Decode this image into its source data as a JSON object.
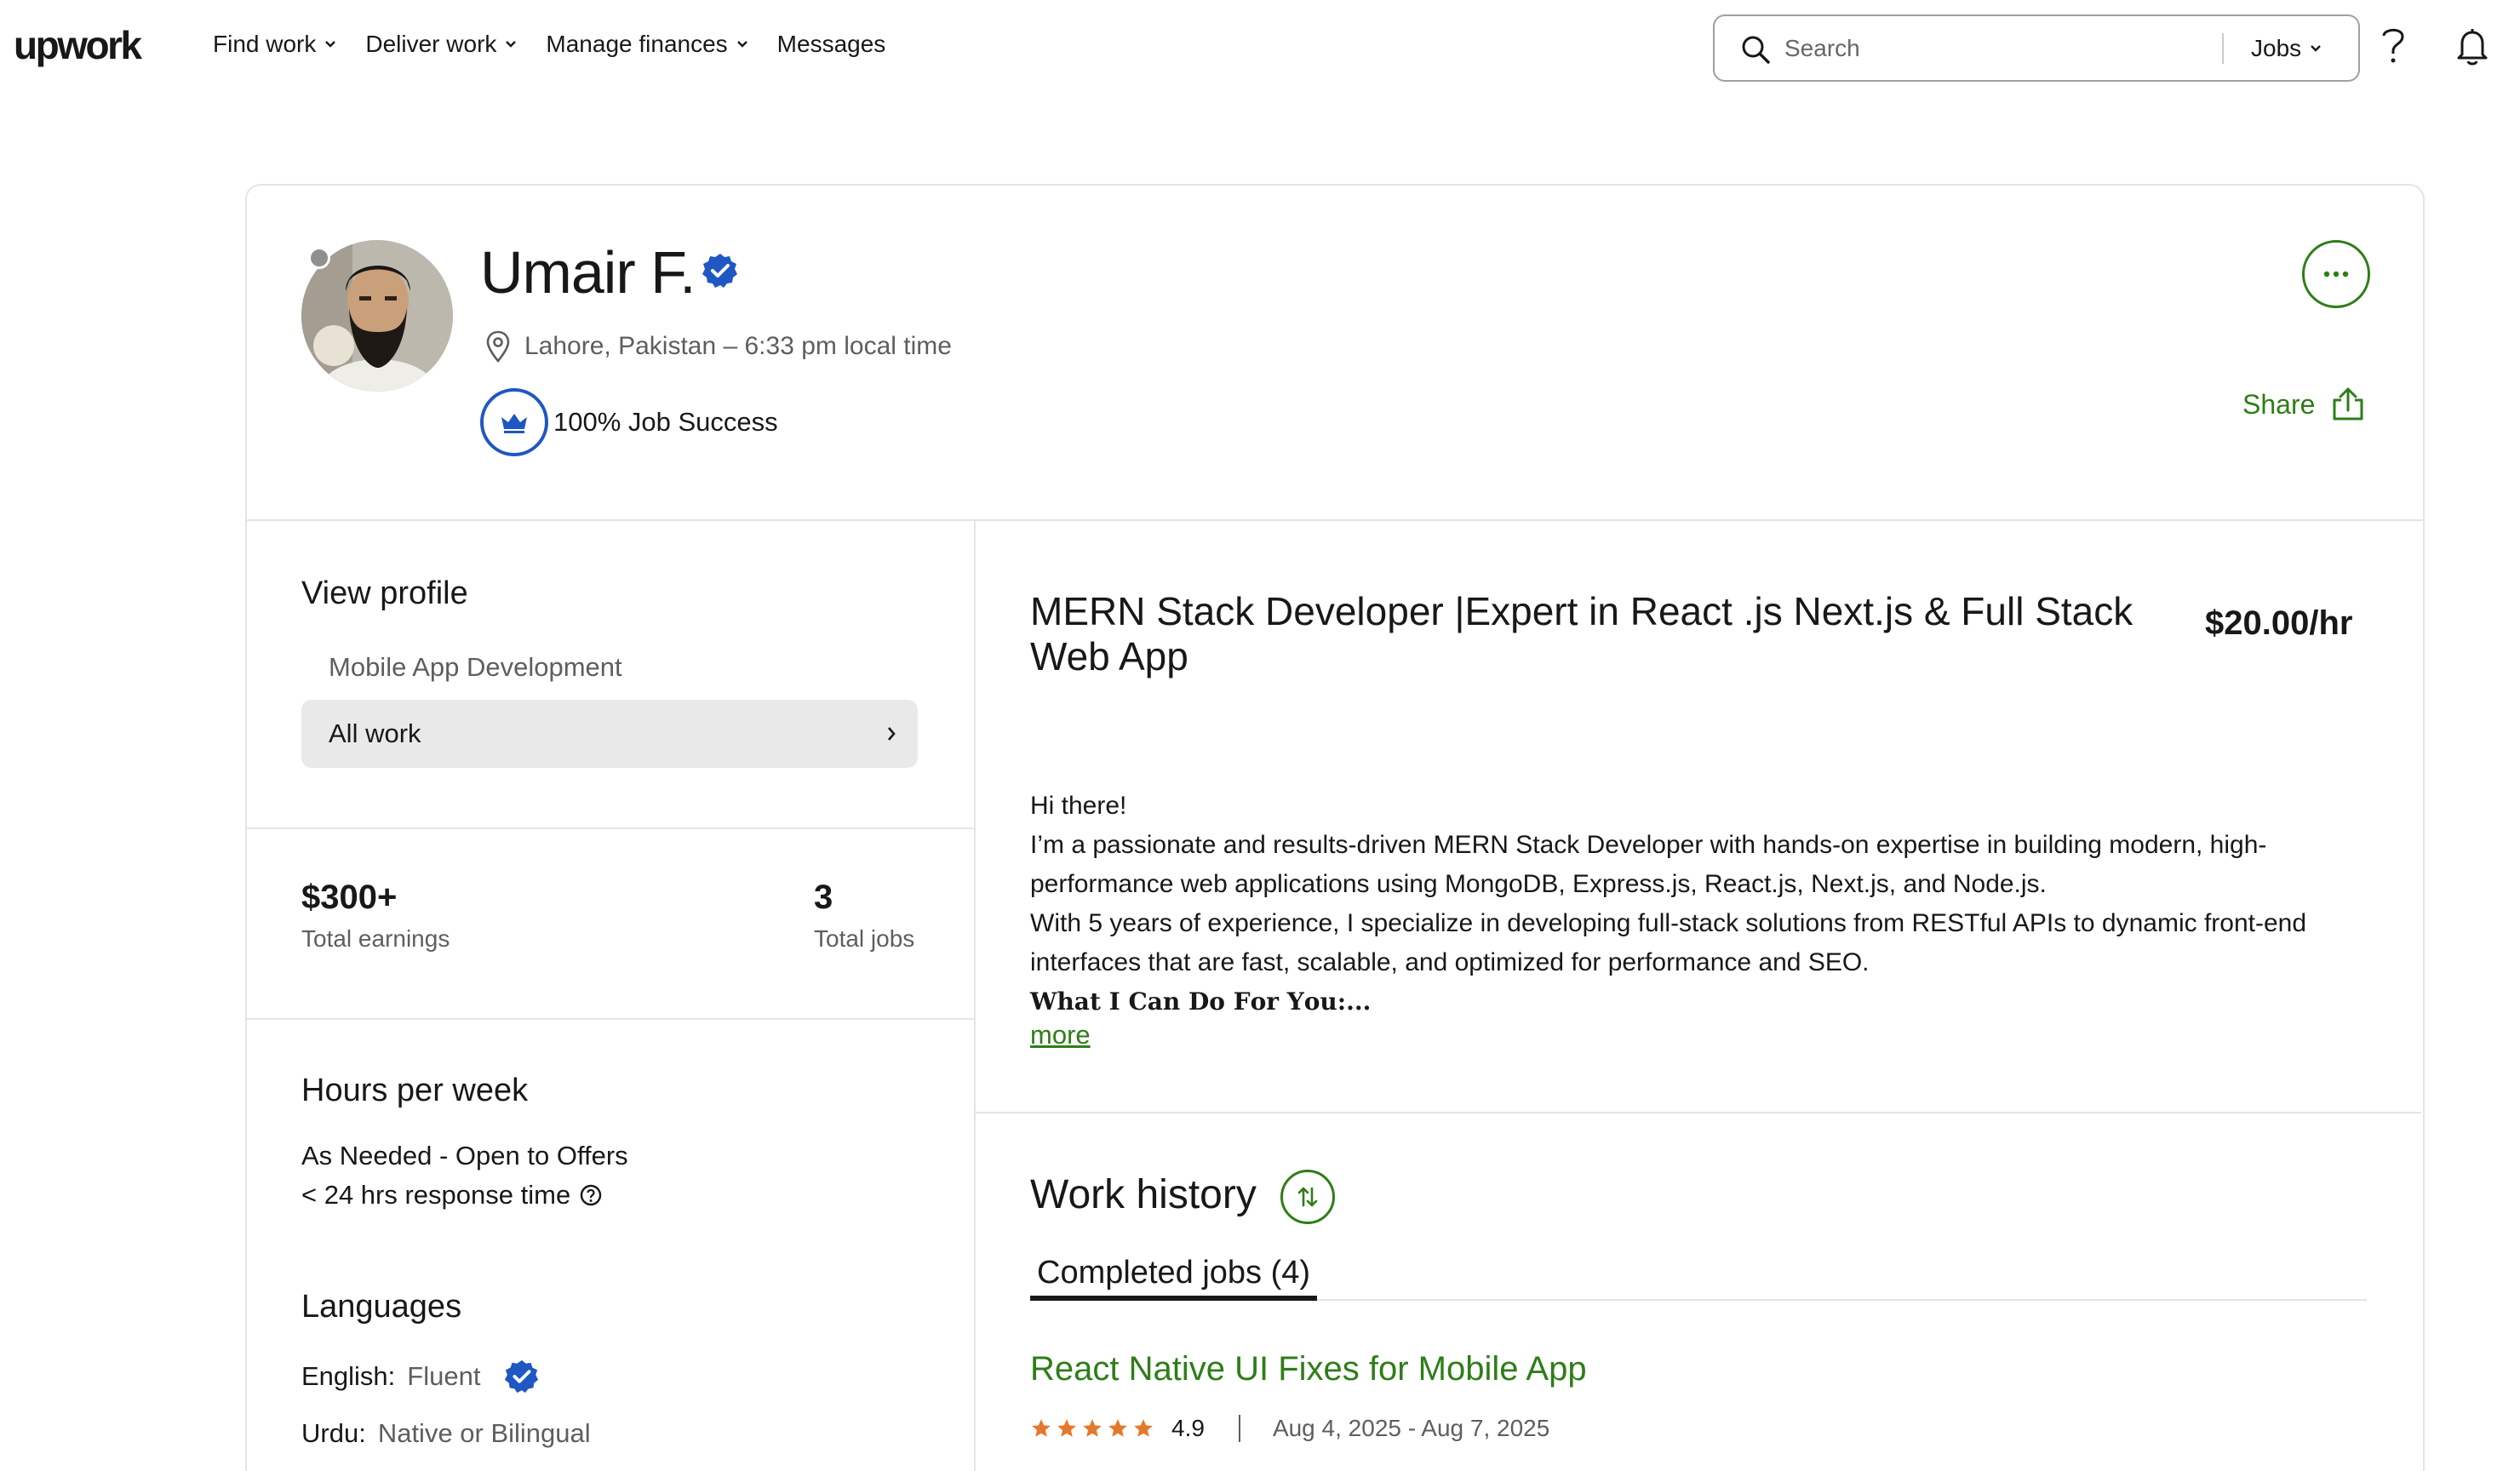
{
  "header": {
    "logo": "upwork",
    "nav": [
      {
        "label": "Find work",
        "has_menu": true
      },
      {
        "label": "Deliver work",
        "has_menu": true
      },
      {
        "label": "Manage finances",
        "has_menu": true
      },
      {
        "label": "Messages",
        "has_menu": false
      }
    ],
    "search": {
      "placeholder": "Search",
      "scope": "Jobs"
    },
    "icons": [
      "search-icon",
      "help-icon",
      "notification-bell-icon"
    ]
  },
  "profile": {
    "name": "Umair F.",
    "location": "Lahore, Pakistan – 6:33 pm local time",
    "job_success": "100% Job Success",
    "share_label": "Share",
    "status_color": "#8f8f8f"
  },
  "sidebar": {
    "view_profile_title": "View profile",
    "profile_options": [
      "Mobile App Development"
    ],
    "selected_profile": "All work",
    "earnings": {
      "value": "$300+",
      "label": "Total earnings"
    },
    "jobs": {
      "value": "3",
      "label": "Total jobs"
    },
    "hours": {
      "title": "Hours per week",
      "availability": "As Needed - Open to Offers",
      "response": "< 24 hrs response time"
    },
    "languages": {
      "title": "Languages",
      "items": [
        {
          "name": "English:",
          "level": "Fluent",
          "verified": true
        },
        {
          "name": "Urdu:",
          "level": "Native or Bilingual",
          "verified": false
        }
      ]
    }
  },
  "main": {
    "headline": "MERN Stack Developer |Expert in React .js Next.js & Full Stack Web App",
    "rate": "$20.00/hr",
    "overview": [
      "Hi there!",
      "I’m a passionate and results-driven MERN Stack Developer with hands-on expertise in building modern, high-performance web applications using MongoDB, Express.js, React.js, Next.js, and Node.js.",
      "With 5 years of experience, I specialize in developing full-stack solutions from RESTful APIs to dynamic front-end interfaces that are fast, scalable, and optimized for performance and SEO."
    ],
    "overview_bold": "𝐖𝐡𝐚𝐭 𝐈 𝐂𝐚𝐧 𝐃𝐨 𝐅𝐨𝐫 𝐘𝐨𝐮:...",
    "more_label": "more",
    "work_history": {
      "title": "Work history",
      "tab": "Completed jobs (4)",
      "jobs": [
        {
          "title": "React Native UI Fixes for Mobile App",
          "rating": "4.9",
          "stars": 5,
          "dates": "Aug 4, 2025 - Aug 7, 2025"
        }
      ]
    }
  },
  "colors": {
    "brand_green": "#2e7d18",
    "verified_blue": "#1f57c3",
    "star_orange": "#e5782b"
  }
}
